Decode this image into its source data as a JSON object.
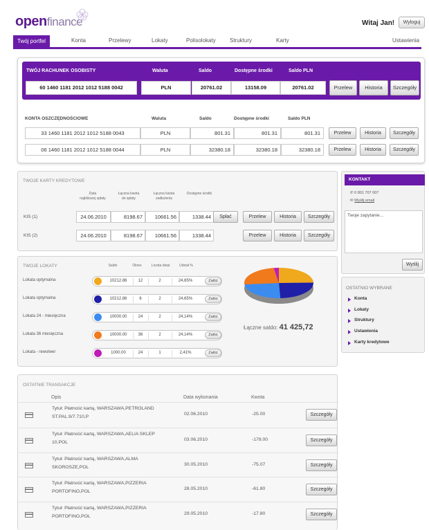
{
  "header": {
    "logo_bold": "open",
    "logo_light": "finance",
    "greeting": "Witaj Jan!",
    "logout_label": "Wyloguj"
  },
  "nav": {
    "tabs": [
      "Twój portfel",
      "Konta",
      "Przelewy",
      "Lokaty",
      "Polisolokaty",
      "Struktury",
      "Karty",
      "Ustawienia"
    ]
  },
  "personal_account": {
    "heading": "TWÓJ RACHUNEK OSOBISTY",
    "col_currency": "Waluta",
    "col_balance": "Saldo",
    "col_available": "Dostępne środki",
    "col_balance_pln": "Saldo PLN",
    "number": "60 1460 1181 2012 1012 5188 0042",
    "currency": "PLN",
    "balance": "20761.02",
    "available": "13158.09",
    "balance_pln": "20761.02",
    "btn_transfer": "Przelew",
    "btn_history": "Historia",
    "btn_details": "Szczegóły"
  },
  "savings": {
    "heading": "KONTA OSZCZĘDNOŚCIOWE",
    "col_currency": "Waluta",
    "col_balance": "Saldo",
    "col_available": "Dostępne środki",
    "col_balance_pln": "Saldo PLN",
    "rows": [
      {
        "number": "33 1460 1181 2012 1012 5188 0043",
        "currency": "PLN",
        "balance": "801.31",
        "available": "801.31",
        "balance_pln": "801.31"
      },
      {
        "number": "06 1460 1181 2012 1012 5188 0044",
        "currency": "PLN",
        "balance": "32380.18",
        "available": "32380.18",
        "balance_pln": "32380.18"
      }
    ],
    "btn_transfer": "Przelew",
    "btn_history": "Historia",
    "btn_details": "Szczegóły"
  },
  "cards": {
    "title": "TWOJE KARTY KREDYTOWE",
    "col_date": [
      "Data",
      "najbliższej spłaty"
    ],
    "col_due": [
      "Łączna kwota",
      "do spłaty"
    ],
    "col_debt": [
      "Łączna kwota",
      "zadłużenia"
    ],
    "col_available": "Dostępne środki",
    "rows": [
      {
        "name": "KIS (1)",
        "date": "24.06.2010",
        "due": "8198.67",
        "debt": "10661.56",
        "available": "1338.44"
      },
      {
        "name": "KIS (2)",
        "date": "24.06.2010",
        "due": "8198.67",
        "debt": "10661.56",
        "available": "1338.44"
      }
    ],
    "btn_repay": "Spłać",
    "btn_transfer": "Przelew",
    "btn_history": "Historia",
    "btn_details": "Szczegóły"
  },
  "deposits": {
    "title": "TWOJE LOKATY",
    "col_balance": "Saldo",
    "col_period": "Okres",
    "col_count": "Liczba lokat",
    "col_share": "Udział %",
    "rows": [
      {
        "name": "Lokata optymalna",
        "color": "#f0a81c",
        "balance": "10212.86",
        "period": "12",
        "count": "2",
        "share": "24,65%",
        "share_value": 24.65
      },
      {
        "name": "Lokata optymalna",
        "color": "#1f1fa8",
        "balance": "10212.86",
        "period": "6",
        "count": "2",
        "share": "24,65%",
        "share_value": 24.65
      },
      {
        "name": "Lokata 24 - miesięczna",
        "color": "#3c8cf0",
        "balance": "10000.00",
        "period": "24",
        "count": "2",
        "share": "24,14%",
        "share_value": 24.14
      },
      {
        "name": "Lokata 36 miesięczna",
        "color": "#f07a1c",
        "balance": "10000.00",
        "period": "36",
        "count": "2",
        "share": "24,14%",
        "share_value": 24.14
      },
      {
        "name": "Lokata - rewolwer",
        "color": "#c01cb8",
        "balance": "1000.00",
        "period": "24",
        "count": "1",
        "share": "2,41%",
        "share_value": 2.41
      }
    ],
    "btn_open": "Załóż",
    "total_label": "Łączne saldo:",
    "total_value": "41 425,72"
  },
  "contact": {
    "title": "KONTAKT",
    "phone": "0 801 707 007",
    "email_link": "Wyślij email",
    "placeholder": "Twoje zapytanie...",
    "send_label": "Wyślij"
  },
  "recent": {
    "title": "OSTATNIO WYBRANE",
    "items": [
      "Konta",
      "Lokaty",
      "Struktury",
      "Ustawienia",
      "Karty kredytowe"
    ]
  },
  "transactions": {
    "title": "OSTATNIE TRANSAKCJE",
    "col_desc": "Opis",
    "col_date": "Data wykonania",
    "col_amount": "Kwota",
    "btn_details": "Szczegóły",
    "rows": [
      {
        "line1": "Tytuł: Płatność kartą, WARSZAWA,PETROLAND",
        "line2": "ST.PAL.9/7.710,P",
        "date": "02.06.2010",
        "amount": "-25.00"
      },
      {
        "line1": "Tytuł: Płatność kartą, WARSZAWA,AELIA SKLEP",
        "line2": "10,POL",
        "date": "03.06.2010",
        "amount": "-178.00"
      },
      {
        "line1": "Tytuł: Płatność kartą, WARSZAWA,ALMA",
        "line2": "SKOROSZE,POL",
        "date": "30.05.2010",
        "amount": "-75.07"
      },
      {
        "line1": "Tytuł: Płatność kartą, WARSZAWA,PIZZERIA",
        "line2": "PORTOFINO,POL",
        "date": "28.05.2010",
        "amount": "-61.80"
      },
      {
        "line1": "Tytuł: Płatność kartą, WARSZAWA,PIZZERIA",
        "line2": "PORTOFINO,POL",
        "date": "29.05.2010",
        "amount": "-17.80"
      }
    ]
  }
}
